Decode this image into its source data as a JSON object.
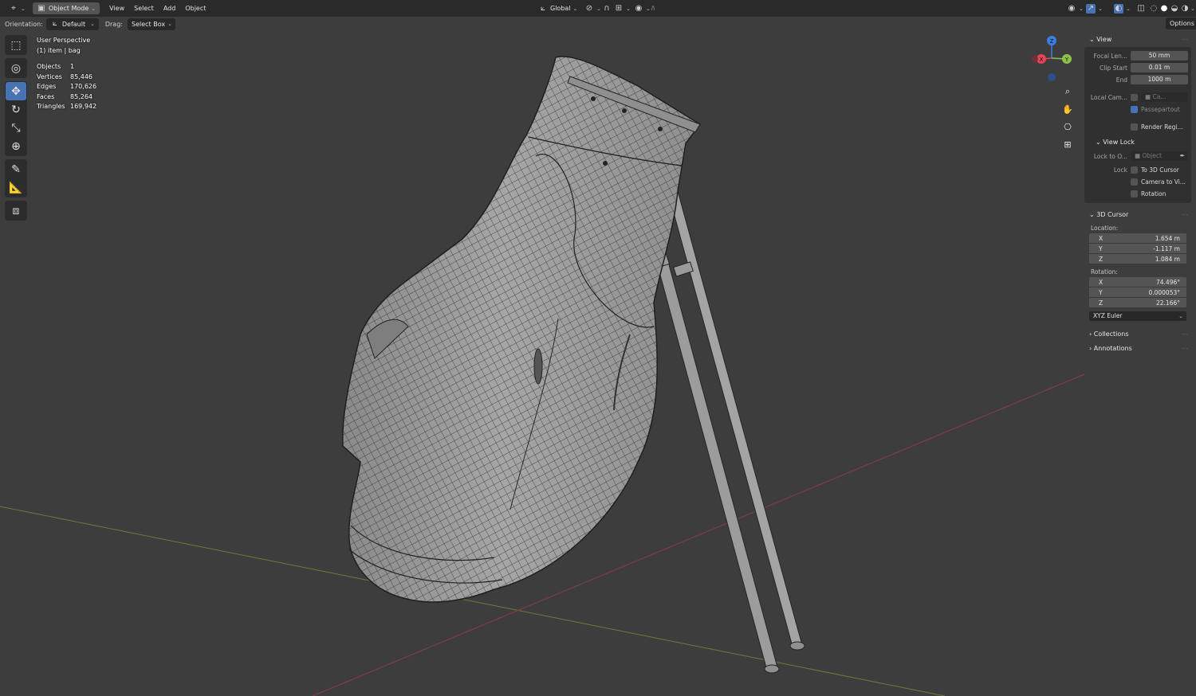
{
  "header": {
    "mode": "Object Mode",
    "menus": [
      "View",
      "Select",
      "Add",
      "Object"
    ],
    "transform_orientation": "Global",
    "options": "Options"
  },
  "tool_settings": {
    "orientation_label": "Orientation:",
    "orientation_value": "Default",
    "drag_label": "Drag:",
    "drag_value": "Select Box"
  },
  "overlay": {
    "view_name": "User Perspective",
    "context": "(1) item | bag",
    "stats": [
      {
        "label": "Objects",
        "value": "1"
      },
      {
        "label": "Vertices",
        "value": "85,446"
      },
      {
        "label": "Edges",
        "value": "170,626"
      },
      {
        "label": "Faces",
        "value": "85,264"
      },
      {
        "label": "Triangles",
        "value": "169,942"
      }
    ]
  },
  "gizmo": {
    "x": "X",
    "y": "Y",
    "z": "Z"
  },
  "npanel": {
    "view": {
      "title": "View",
      "focal_label": "Focal Len...",
      "focal_value": "50 mm",
      "clip_start_label": "Clip Start",
      "clip_start_value": "0.01 m",
      "end_label": "End",
      "end_value": "1000 m",
      "local_cam_label": "Local Cam...",
      "local_cam_value": "Ca...",
      "passepartout": "Passepartout",
      "render_region": "Render Regi..."
    },
    "view_lock": {
      "title": "View Lock",
      "lock_to_label": "Lock to O...",
      "lock_to_value": "Object",
      "lock_label": "Lock",
      "to_3d_cursor": "To 3D Cursor",
      "camera_to_view": "Camera to Vi...",
      "rotation": "Rotation"
    },
    "cursor": {
      "title": "3D Cursor",
      "location_label": "Location:",
      "location": [
        {
          "axis": "X",
          "value": "1.654 m"
        },
        {
          "axis": "Y",
          "value": "-1.117 m"
        },
        {
          "axis": "Z",
          "value": "1.084 m"
        }
      ],
      "rotation_label": "Rotation:",
      "rotation": [
        {
          "axis": "X",
          "value": "74.496°"
        },
        {
          "axis": "Y",
          "value": "0.000053°"
        },
        {
          "axis": "Z",
          "value": "22.166°"
        }
      ],
      "rotation_mode": "XYZ Euler"
    },
    "collections": "Collections",
    "annotations": "Annotations"
  },
  "colors": {
    "viewport_bg": "#3d3d3d",
    "accent": "#4772b3",
    "axis_x": "#e8435a",
    "axis_y": "#8bc34a",
    "axis_z": "#3d7de0"
  }
}
